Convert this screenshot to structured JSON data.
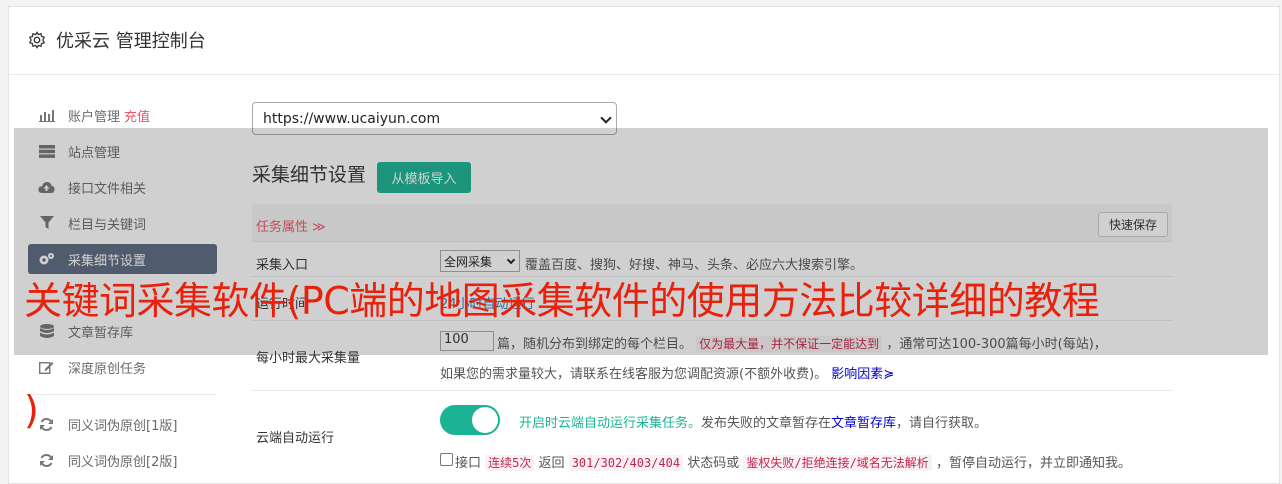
{
  "header": {
    "title": "优采云 管理控制台",
    "icon": "gear-icon"
  },
  "sidebar": {
    "items": [
      {
        "label": "账户管理",
        "extra": "充值",
        "icon": "bar-chart-icon"
      },
      {
        "label": "站点管理",
        "icon": "server-icon"
      },
      {
        "label": "接口文件相关",
        "icon": "cloud-upload-icon"
      },
      {
        "label": "栏目与关键词",
        "icon": "filter-icon"
      },
      {
        "label": "采集细节设置",
        "icon": "cogs-icon",
        "active": true
      },
      {
        "label": "文章暂存库",
        "icon": "database-icon"
      },
      {
        "label": "深度原创任务",
        "icon": "edit-icon"
      },
      {
        "label": "同义词伪原创[1版]",
        "icon": "refresh-icon"
      },
      {
        "label": "同义词伪原创[2版]",
        "icon": "refresh-icon"
      }
    ]
  },
  "main": {
    "site_select": "https://www.ucaiyun.com",
    "section_title": "采集细节设置",
    "template_button": "从模板导入",
    "task_attr": "任务属性 ≫",
    "quick_save": "快速保存",
    "rows": {
      "entry": {
        "label": "采集入口",
        "select": "全网采集",
        "desc": "覆盖百度、搜狗、好搜、神马、头条、必应六大搜索引擎。"
      },
      "time": {
        "label": "运行时间",
        "desc": "24小时自动运行"
      },
      "max": {
        "label": "每小时最大采集量",
        "value": "100",
        "desc1": "篇，随机分布到绑定的每个栏目。",
        "code": "仅为最大量，并不保证一定能达到",
        "desc2": "，通常可达100-300篇每小时(每站)，",
        "desc3": "如果您的需求量较大，请联系在线客服为您调配资源(不额外收费)。",
        "link": "影响因素"
      },
      "auto": {
        "label": "云端自动运行",
        "toggle_text": "开启时云端自动运行采集任务。",
        "desc1": "发布失败的文章暂存在",
        "link": "文章暂存库",
        "desc2": "，请自行获取。",
        "chk_label": "接口",
        "code1": "连续5次",
        "mid1": "返回",
        "code2": "301/302/403/404",
        "mid2": "状态码或",
        "code3": "鉴权失败/拒绝连接/域名无法解析",
        "tail": "，暂停自动运行，并立即通知我。"
      }
    }
  },
  "overlay": {
    "title": "关键词采集软件(PC端的地图采集软件的使用方法比较详细的教程",
    "paren": ")"
  }
}
